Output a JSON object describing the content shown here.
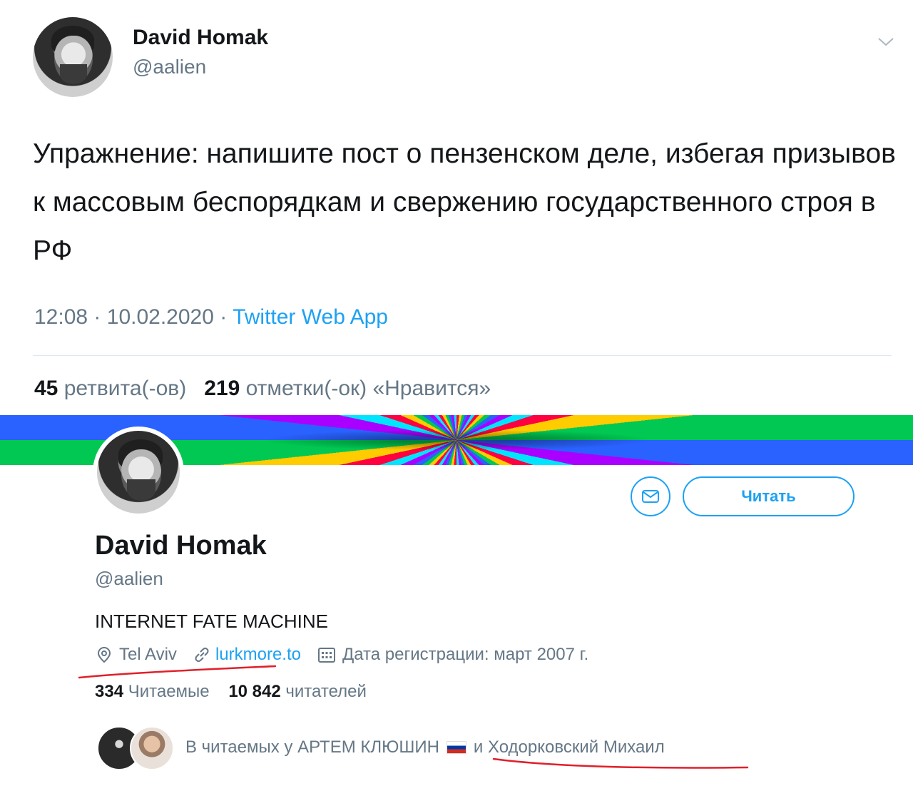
{
  "tweet": {
    "author_name": "David Homak",
    "author_handle": "@aalien",
    "text": "Упражнение: напишите пост о пензенском деле, избегая призывов к массовым беспорядкам и свержению государственного строя в РФ",
    "time": "12:08",
    "date": "10.02.2020",
    "separator": "·",
    "app": "Twitter Web App",
    "retweets_count": "45",
    "retweets_label": "ретвита(-ов)",
    "likes_count": "219",
    "likes_label": "отметки(-ок) «Нравится»",
    "menu_icon": "chevron-down-icon"
  },
  "profile": {
    "name": "David Homak",
    "handle": "@aalien",
    "bio": "INTERNET FATE MACHINE",
    "location": "Tel Aviv",
    "website": "lurkmore.to",
    "joined": "Дата регистрации: март 2007 г.",
    "following_count": "334",
    "following_label": "Читаемые",
    "followers_count": "10 842",
    "followers_label": "читателей",
    "follow_button": "Читать",
    "followed_by_text": "В читаемых у АРТЕМ КЛЮШИН",
    "followed_by_more": "и Ходорковский Михаил"
  },
  "colors": {
    "accent": "#1da1f2",
    "secondary_text": "#657786",
    "annotation_red": "#e0202a"
  }
}
